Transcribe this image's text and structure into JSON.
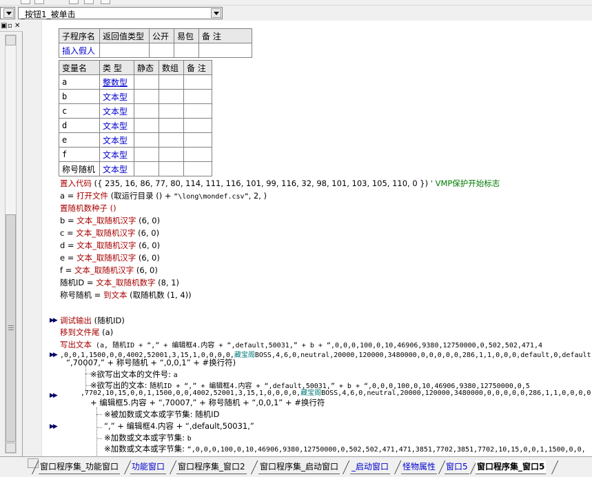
{
  "combo": {
    "left_value": "",
    "event_value": "_按钮1_被单击"
  },
  "sub_table": {
    "headers": [
      "子程序名",
      "返回值类型",
      "公开",
      "易包",
      "备 注"
    ],
    "row": [
      "插入假人",
      "",
      "",
      "",
      ""
    ]
  },
  "var_table": {
    "headers": [
      "变量名",
      "类 型",
      "静态",
      "数组",
      "备 注"
    ],
    "rows": [
      {
        "name": "a",
        "type": "整数型"
      },
      {
        "name": "b",
        "type": "文本型"
      },
      {
        "name": "c",
        "type": "文本型"
      },
      {
        "name": "d",
        "type": "文本型"
      },
      {
        "name": "e",
        "type": "文本型"
      },
      {
        "name": "f",
        "type": "文本型"
      },
      {
        "name": "称号随机",
        "type": "文本型"
      }
    ]
  },
  "code": {
    "l1_cmd": "置入代码",
    "l1_args": " ({ 235, 16, 86, 77, 80, 114, 111, 116, 101, 99, 116, 32, 98, 101, 103, 105, 110, 0 }) ",
    "l1_comment": "' VMP保护开始标志",
    "l2_a": "a = ",
    "l2_b": "打开文件",
    "l2_c": " (取运行目录 () + ",
    "l2_d": "“\\long\\mondef.csv”",
    "l2_e": ", 2, )",
    "l3": "置随机数种子 ()",
    "l4_a": "b = ",
    "l4_b": "文本_取随机汉字",
    "l4_c": " (6, 0)",
    "l5_a": "c = ",
    "l5_b": "文本_取随机汉字",
    "l5_c": " (6, 0)",
    "l6_a": "d = ",
    "l6_b": "文本_取随机汉字",
    "l6_c": " (6, 0)",
    "l7_a": "e = ",
    "l7_b": "文本_取随机汉字",
    "l7_c": " (6, 0)",
    "l8_a": "f = ",
    "l8_b": "文本_取随机汉字",
    "l8_c": " (6, 0)",
    "l9_a": "随机ID = ",
    "l9_b": "文本_取随机数字",
    "l9_c": " (8, 1)",
    "l10_a": "称号随机 = ",
    "l10_b": "到文本",
    "l10_c": " (取随机数 (1, 4))",
    "l11_a": "调试输出",
    "l11_b": " (随机ID)",
    "l12_a": "移到文件尾",
    "l12_b": " (a)",
    "l13_a": "写出文本",
    "l13_b": " (a, 随机ID + “,” + 编辑框4.内容 + “,default,50031,” + b + “,0,0,0,100,0,10,46906,9380,12750000,0,502,502,471,4",
    "l14_a": ",0,0,1,1500,0,0,4002,52001,3,15,1,0,0,0,0,",
    "l14_b": "藏宝阁",
    "l14_c": "BOSS,4,6,0,neutral,20000,120000,3480000,0,0,0,0,0,286,1,1,0,0,0,default,0,default",
    "l15": "“,70007,” + 称号随机 + “,0,0,1” + #换行符)",
    "l16_a": "※欲写出文本的文件号: ",
    "l16_b": "a",
    "l17_a": "※欲写出的文本: ",
    "l17_b": "随机ID + “,” + 编辑框4.内容 + “,default,50031,” + b + “,0,0,0,100,0,10,46906,9380,12750000,0,5",
    "l18_a": ",7702,10,15,0,0,1,1500,0,0,4002,52001,3,15,1,0,0,0,0,",
    "l18_b": "藏宝阁",
    "l18_c": "BOSS,4,6,0,neutral,20000,120000,3480000,0,0,0,0,0,286,1,1,0,0,0,0",
    "l19": "+ 编辑框5.内容 + “,70007,” + 称号随机 + “,0,0,1” + #换行符",
    "l20_a": "※被加数或文本或字节集: ",
    "l20_b": "随机ID",
    "l21_a": "“,” + 编辑框4.内容 + “,default,50031,”",
    "l22_a": "※加数或文本或字节集: ",
    "l22_b": "b",
    "l23_a": "※加数或文本或字节集: ",
    "l23_b": "“,0,0,0,100,0,10,46906,9380,12750000,0,502,502,471,471,3851,7702,3851,7702,10,15,0,0,1,1500,0,0,"
  },
  "tabs": [
    {
      "label": "窗口程序集_功能窗口",
      "color": "#000000"
    },
    {
      "label": "功能窗口",
      "color": "#0000cc"
    },
    {
      "label": "窗口程序集_窗口2",
      "color": "#000000"
    },
    {
      "label": "窗口程序集_启动窗口",
      "color": "#000000"
    },
    {
      "label": "_启动窗口",
      "color": "#0000cc"
    },
    {
      "label": "怪物属性",
      "color": "#0000cc"
    },
    {
      "label": "窗口5",
      "color": "#0000cc"
    },
    {
      "label": "窗口程序集_窗口5",
      "color": "#000000",
      "active": true
    }
  ]
}
